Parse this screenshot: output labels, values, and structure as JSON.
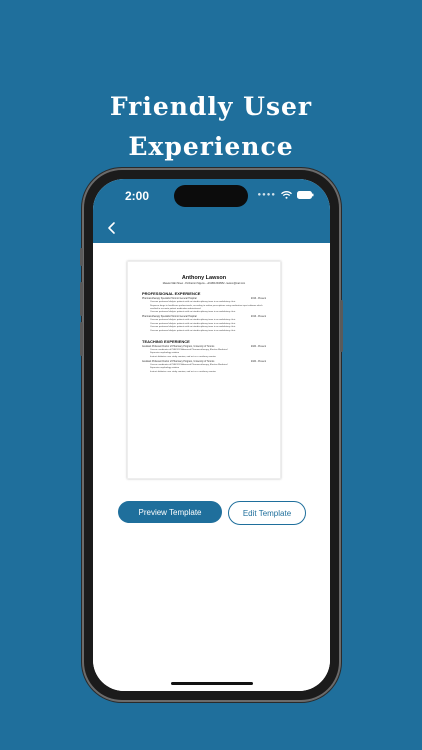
{
  "headline": {
    "line1": "Friendly User",
    "line2": "Experience"
  },
  "status_bar": {
    "time": "2:00"
  },
  "resume": {
    "name": "Anthony Lawson",
    "contact": "Maseko Mabi Street - Portharcort Nigeria - +2348013348952 - lawson@mail.com",
    "sections": [
      {
        "title": "PROFESSIONAL EXPERIENCE",
        "jobs": [
          {
            "title": "Pharmacotherapy Specialist Toronto General Hospital",
            "dates": "2016 - Present",
            "bullets": [
              "Oversee peritoneal dialysis patients with an interdisciplinary team in an ambulatory clinic",
              "Dispense drugs to healthcare professionals, according to written prescriptions using medication input software which resulted in accurate patient medication administered",
              "Oversee peritoneal dialysis patients with an interdisciplinary team in an ambulatory clinic"
            ]
          },
          {
            "title": "Pharmacotherapy Specialist Toronto General Hospital",
            "dates": "2016 - Present",
            "bullets": [
              "Oversee peritoneal dialysis patients with an interdisciplinary team in an ambulatory clinic",
              "Oversee peritoneal dialysis patients with an interdisciplinary team in an ambulatory clinic",
              "Oversee peritoneal dialysis patients with an interdisciplinary team in an ambulatory clinic",
              "Oversee peritoneal dialysis patients with an interdisciplinary team in an ambulatory clinic"
            ]
          }
        ]
      },
      {
        "title": "TEACHING EXPERIENCE",
        "jobs": [
          {
            "title": "Assistant Professor Doctor of Pharmacy Program, University of Toronto",
            "dates": "2020 - Present",
            "bullets": [
              "Course coordinator of PHM 612 Advanced Pharmacotherapy, Elective Medicine I",
              "Supervise nephrology rotation",
              "Instruct diabetes case study seminar, and act as a residency mentor"
            ]
          },
          {
            "title": "Assistant Professor Doctor of Pharmacy Program, University of Toronto",
            "dates": "2020 - Present",
            "bullets": [
              "Course coordinator of PHM 612 Advanced Pharmacotherapy, Elective Medicine I",
              "Supervise nephrology rotation",
              "Instruct diabetes case study seminar, and act as a residency mentor"
            ]
          }
        ]
      }
    ]
  },
  "buttons": {
    "preview": "Preview Template",
    "edit": "Edit Template"
  },
  "colors": {
    "brand": "#1f6f9c",
    "background": "#1f6f9c",
    "screen": "#ffffff"
  }
}
